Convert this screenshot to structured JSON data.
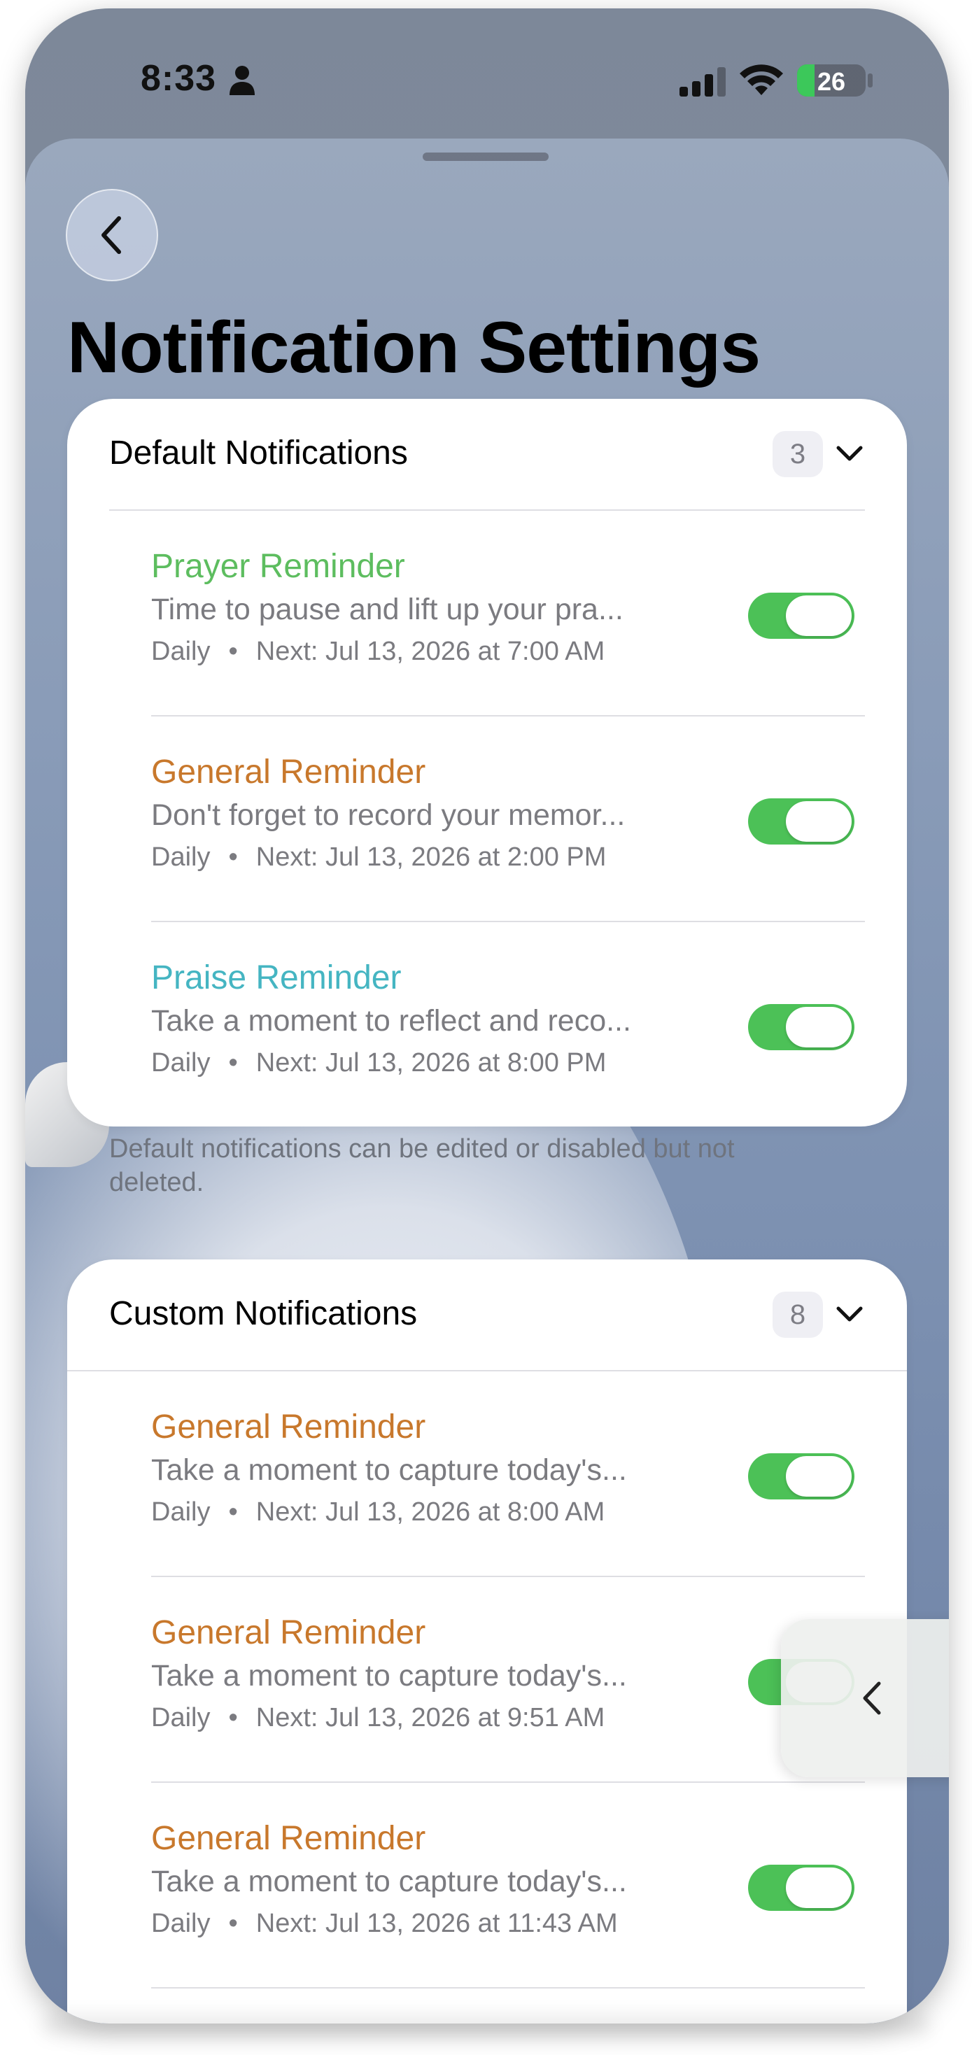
{
  "status_bar": {
    "time": "8:33",
    "battery_level": "26",
    "icons": [
      "person-icon",
      "signal-icon",
      "wifi-icon",
      "battery-icon"
    ]
  },
  "header": {
    "back_icon": "chevron-left-icon",
    "title": "Notification Settings"
  },
  "default_section": {
    "title": "Default Notifications",
    "count": "3",
    "footnote": "Default notifications can be edited or disabled but not deleted.",
    "items": [
      {
        "title": "Prayer Reminder",
        "title_color": "#5dbd5f",
        "message": "Time to pause and lift up your pra...",
        "frequency": "Daily",
        "separator": "•",
        "next": "Next: Jul 13, 2026 at 7:00 AM",
        "enabled": true
      },
      {
        "title": "General Reminder",
        "title_color": "#c8782c",
        "message": "Don't forget to record your memor...",
        "frequency": "Daily",
        "separator": "•",
        "next": "Next: Jul 13, 2026 at 2:00 PM",
        "enabled": true
      },
      {
        "title": "Praise Reminder",
        "title_color": "#45b5c2",
        "message": "Take a moment to reflect and reco...",
        "frequency": "Daily",
        "separator": "•",
        "next": "Next: Jul 13, 2026 at 8:00 PM",
        "enabled": true
      }
    ]
  },
  "custom_section": {
    "title": "Custom Notifications",
    "count": "8",
    "items": [
      {
        "title": "General Reminder",
        "title_color": "#c8782c",
        "message": "Take a moment to capture today's...",
        "frequency": "Daily",
        "separator": "•",
        "next": "Next: Jul 13, 2026 at 8:00 AM",
        "enabled": true
      },
      {
        "title": "General Reminder",
        "title_color": "#c8782c",
        "message": "Take a moment to capture today's...",
        "frequency": "Daily",
        "separator": "•",
        "next": "Next: Jul 13, 2026 at 9:51 AM",
        "enabled": true
      },
      {
        "title": "General Reminder",
        "title_color": "#c8782c",
        "message": "Take a moment to capture today's...",
        "frequency": "Daily",
        "separator": "•",
        "next": "Next: Jul 13, 2026 at 11:43 AM",
        "enabled": true
      }
    ]
  },
  "floating_tab": {
    "icon": "chevron-left-icon"
  },
  "colors": {
    "toggle_on": "#4cc157",
    "prayer": "#5dbd5f",
    "general": "#c8782c",
    "praise": "#45b5c2"
  }
}
